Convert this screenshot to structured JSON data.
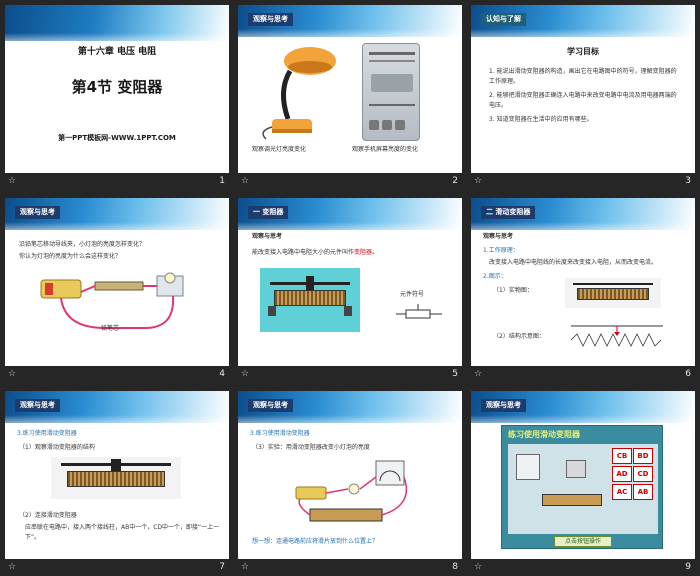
{
  "slides": [
    {
      "num": "1",
      "chapter": "第十六章 电压 电阻",
      "title": "第4节  变阻器",
      "site": "第一PPT模板网-WWW.1PPT.COM"
    },
    {
      "num": "2",
      "tag": "观察与思考",
      "cap_left": "观察调光灯亮度变化",
      "cap_right": "观察手机屏幕亮度的变化"
    },
    {
      "num": "3",
      "tag": "认知与了解",
      "heading": "学习目标",
      "goals": [
        "1. 能说出滑动变阻器的构造，画出它在电路图中的符号，理解变阻器的工作原理。",
        "2. 能够把滑动变阻器正确连入电路中来改变电路中电流及用电器两端的电压。",
        "3. 知道变阻器在生活中的应用有哪些。"
      ]
    },
    {
      "num": "4",
      "tag": "观察与思考",
      "q1": "沿铅笔芯移动导线夹，小灯泡的亮度怎样变化？",
      "q2": "你认为灯泡的亮度为什么会这样变化？",
      "label": "铅笔芯"
    },
    {
      "num": "5",
      "tag": "一  变阻器",
      "sub": "观察与思考",
      "def_a": "能改变接入电路中电阻大小的元件叫作",
      "def_b": "变阻器",
      "def_c": "。",
      "symbol": "元件符号"
    },
    {
      "num": "6",
      "tag": "二  滑动变阻器",
      "sub": "观察与思考",
      "p1": "1.工作原理：",
      "p1b": "改变接入电路中电阻线的长度来改变接入电阻，从而改变电流。",
      "p2": "2.图示：",
      "real": "（1）实物图：",
      "diag": "（2）结构示意图："
    },
    {
      "num": "7",
      "tag": "观察与思考",
      "s1": "3.练习使用滑动变阻器",
      "s2": "（1）观察滑动变阻器的结构",
      "s3": "（2）连接滑动变阻器",
      "s4": "应串联在电路中，接入两个接线柱，AB中一个，CD中一个，即接“一上一下”。"
    },
    {
      "num": "8",
      "tag": "观察与思考",
      "s1": "3.练习使用滑动变阻器",
      "s2": "（3）实验：用滑动变阻器改变小灯泡的亮度",
      "s3": "想一想：连通电路前应将滑片放到什么位置上？"
    },
    {
      "num": "9",
      "tag": "观察与思考",
      "panel_title": "练习使用滑动变阻器",
      "btns": [
        "CB",
        "BD",
        "AD",
        "CD",
        "AC",
        "AB"
      ],
      "bottom": "点击按钮操作"
    }
  ],
  "colors": {
    "accent_blue": "#1f6fb2",
    "red": "#d0021b",
    "dark": "#262626"
  }
}
